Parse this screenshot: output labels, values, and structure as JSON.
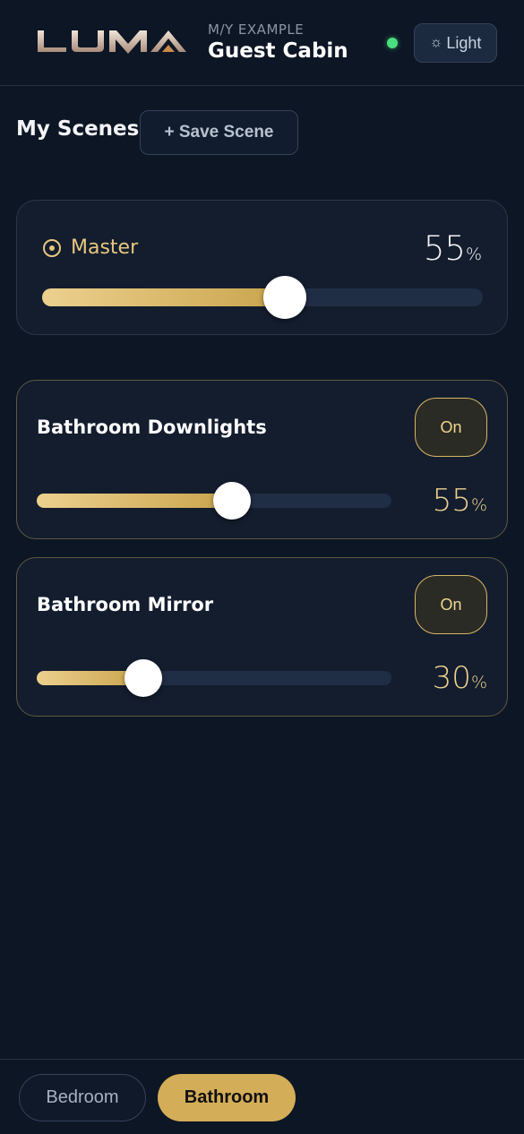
{
  "header": {
    "logo_text": "LUMA",
    "vessel_label": "M/Y EXAMPLE",
    "cabin_title": "Guest Cabin",
    "status_color": "#4ade80",
    "theme_button": {
      "icon": "sun-icon",
      "label": "Light"
    }
  },
  "scenes": {
    "title": "My Scenes",
    "save_button_label": "+ Save Scene"
  },
  "master": {
    "icon": "target-icon",
    "label": "Master",
    "value": "55",
    "unit": "%",
    "level": 0.55
  },
  "lights": [
    {
      "name": "Bathroom Downlights",
      "toggle_label": "On",
      "value": "55",
      "unit": "%",
      "level": 0.55
    },
    {
      "name": "Bathroom Mirror",
      "toggle_label": "On",
      "value": "30",
      "unit": "%",
      "level": 0.3
    }
  ],
  "rooms": {
    "tabs": [
      {
        "label": "Bedroom",
        "active": false
      },
      {
        "label": "Bathroom",
        "active": true
      }
    ]
  },
  "colors": {
    "accent_gold": "#d4ad58",
    "background": "#0d1625"
  }
}
